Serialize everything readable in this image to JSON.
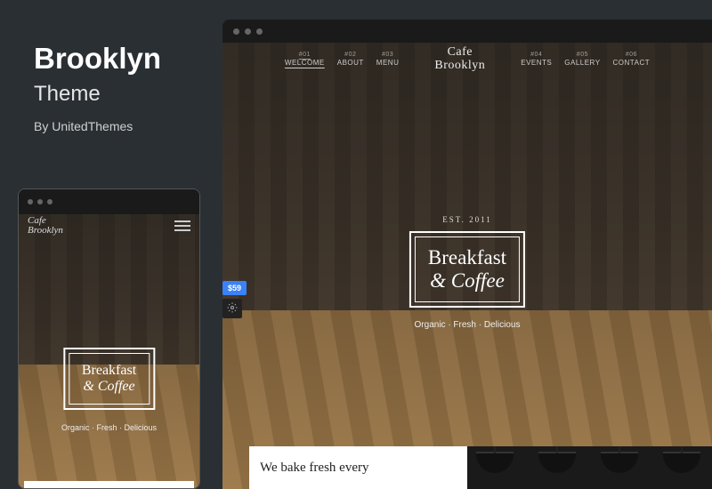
{
  "theme": {
    "title": "Brooklyn",
    "subtitle": "Theme",
    "author": "By UnitedThemes"
  },
  "site": {
    "logo_line1": "Cafe",
    "logo_line2": "Brooklyn",
    "established": "EST. 2011",
    "hero_line1": "Breakfast",
    "hero_line2": "& Coffee",
    "tagline": "Organic · Fresh · Delicious",
    "headline": "We bake fresh every",
    "price": "$59"
  },
  "nav": {
    "items": [
      {
        "id": "#01",
        "label": "WELCOME",
        "active": true
      },
      {
        "id": "#02",
        "label": "ABOUT",
        "active": false
      },
      {
        "id": "#03",
        "label": "MENU",
        "active": false
      },
      {
        "id": "#04",
        "label": "EVENTS",
        "active": false
      },
      {
        "id": "#05",
        "label": "GALLERY",
        "active": false
      },
      {
        "id": "#06",
        "label": "CONTACT",
        "active": false
      }
    ]
  },
  "colors": {
    "page_bg": "#2a2f33",
    "accent": "#3b82f6"
  }
}
